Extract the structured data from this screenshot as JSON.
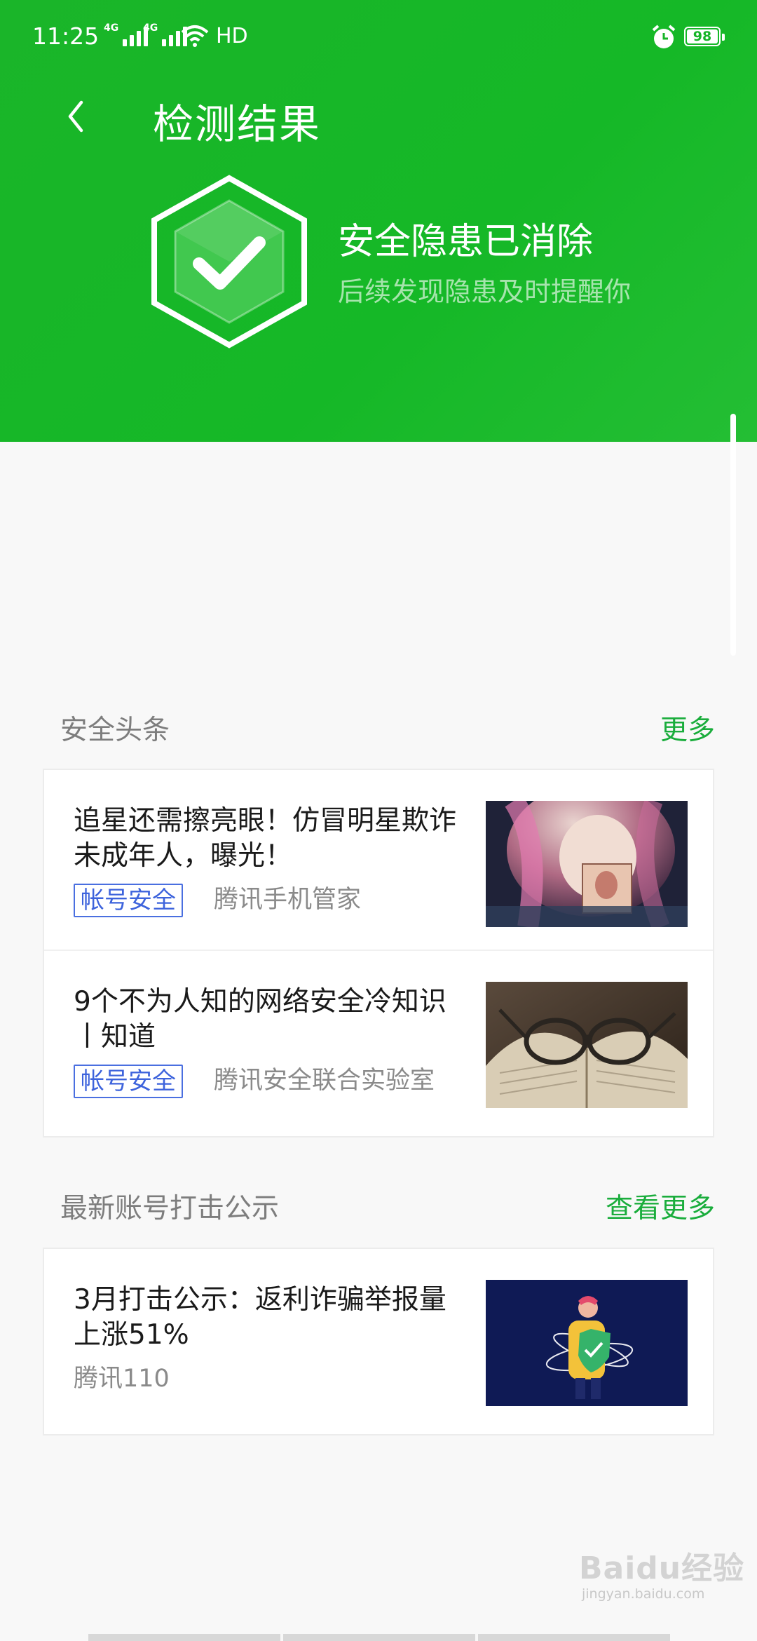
{
  "status_bar": {
    "time": "11:25",
    "network_label_1": "4G",
    "network_label_2": "4G",
    "hd_label": "HD",
    "battery": "98"
  },
  "nav": {
    "title": "检测结果"
  },
  "result": {
    "title": "安全隐患已消除",
    "subtitle": "后续发现隐患及时提醒你"
  },
  "security_news": {
    "title": "安全头条",
    "more": "更多",
    "items": [
      {
        "title": "追星还需擦亮眼！仿冒明星欺诈未成年人，曝光！",
        "tag": "帐号安全",
        "source": "腾讯手机管家"
      },
      {
        "title": "9个不为人知的网络安全冷知识丨知道",
        "tag": "帐号安全",
        "source": "腾讯安全联合实验室"
      }
    ]
  },
  "account_crackdown": {
    "title": "最新账号打击公示",
    "more": "查看更多",
    "items": [
      {
        "title": "3月打击公示：返利诈骗举报量上涨51%",
        "source": "腾讯110"
      }
    ]
  },
  "watermark": {
    "brand": "Baidu经验",
    "url": "jingyan.baidu.com"
  },
  "colors": {
    "header_green": "#16b427",
    "link_green": "#1aad3c",
    "tag_blue": "#3d63dc"
  },
  "icons": [
    "back-arrow-icon",
    "shield-check-icon",
    "alarm-icon",
    "wifi-icon",
    "battery-icon"
  ]
}
